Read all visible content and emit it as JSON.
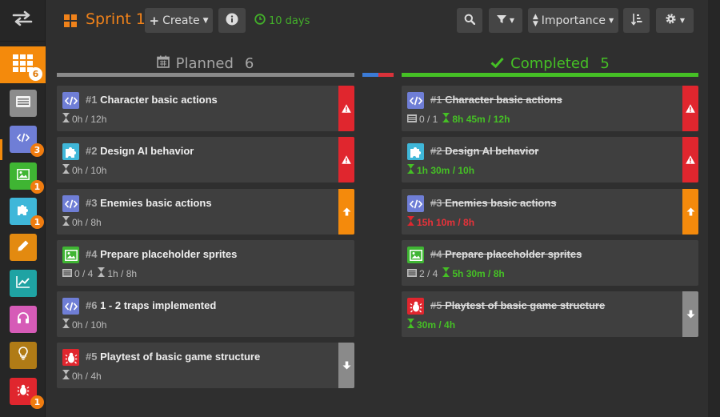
{
  "sidebar": {
    "toggle_icon": "swap-arrows-icon",
    "items": [
      {
        "name": "board",
        "icon": "grid-icon",
        "badge": "6",
        "color": "#f48a0c"
      },
      {
        "name": "backlog",
        "icon": "list-icon",
        "badge": "",
        "color": "#8c8c8c"
      },
      {
        "name": "code",
        "icon": "code-icon",
        "badge": "3",
        "color": "#6f7ed6"
      },
      {
        "name": "graphics",
        "icon": "image-icon",
        "badge": "1",
        "color": "#3fb533"
      },
      {
        "name": "design",
        "icon": "puzzle-icon",
        "badge": "1",
        "color": "#3fb7d9"
      },
      {
        "name": "writing",
        "icon": "pencil-icon",
        "badge": "",
        "color": "#e38a10"
      },
      {
        "name": "stats",
        "icon": "chart-icon",
        "badge": "",
        "color": "#1fa3a3"
      },
      {
        "name": "audio",
        "icon": "headphones-icon",
        "badge": "",
        "color": "#d65bb7"
      },
      {
        "name": "ideas",
        "icon": "lightbulb-icon",
        "badge": "",
        "color": "#b07b16"
      },
      {
        "name": "bugs",
        "icon": "bug-icon",
        "badge": "1",
        "color": "#e0262e"
      }
    ]
  },
  "header": {
    "title": "Sprint 1",
    "create_label": "Create",
    "days_label": "10 days",
    "sort_label": "Importance"
  },
  "columns": [
    {
      "name": "Planned",
      "count": "6",
      "cards": [
        {
          "num": "#1",
          "title": "Character basic actions",
          "type": "code",
          "time": "0h / 12h",
          "tasks": "",
          "spent_style": "plain",
          "priority": "critical"
        },
        {
          "num": "#2",
          "title": "Design AI behavior",
          "type": "design",
          "time": "0h / 10h",
          "tasks": "",
          "spent_style": "plain",
          "priority": "critical"
        },
        {
          "num": "#3",
          "title": "Enemies basic actions",
          "type": "code",
          "time": "0h / 8h",
          "tasks": "",
          "spent_style": "plain",
          "priority": "high"
        },
        {
          "num": "#4",
          "title": "Prepare placeholder sprites",
          "type": "graphics",
          "time": "1h / 8h",
          "tasks": "0 / 4",
          "spent_style": "plain",
          "priority": "none"
        },
        {
          "num": "#6",
          "title": "1 - 2 traps implemented",
          "type": "code",
          "time": "0h / 10h",
          "tasks": "",
          "spent_style": "plain",
          "priority": "none"
        },
        {
          "num": "#5",
          "title": "Playtest of basic game structure",
          "type": "bug",
          "time": "0h / 4h",
          "tasks": "",
          "spent_style": "plain",
          "priority": "low"
        }
      ]
    },
    {
      "name": "Completed",
      "count": "5",
      "cards": [
        {
          "num": "#1",
          "title": "Character basic actions",
          "type": "code",
          "time": "8h 45m / 12h",
          "tasks": "0 / 1",
          "spent_style": "green",
          "priority": "critical"
        },
        {
          "num": "#2",
          "title": "Design AI behavior",
          "type": "design",
          "time": "1h 30m / 10h",
          "tasks": "",
          "spent_style": "green",
          "priority": "critical"
        },
        {
          "num": "#3",
          "title": "Enemies basic actions",
          "type": "code",
          "time": "15h 10m / 8h",
          "tasks": "",
          "spent_style": "red",
          "priority": "high"
        },
        {
          "num": "#4",
          "title": "Prepare placeholder sprites",
          "type": "graphics",
          "time": "5h 30m / 8h",
          "tasks": "2 / 4",
          "spent_style": "green",
          "priority": "none"
        },
        {
          "num": "#5",
          "title": "Playtest of basic game structure",
          "type": "bug",
          "time": "30m / 4h",
          "tasks": "",
          "spent_style": "green",
          "priority": "low"
        }
      ]
    }
  ],
  "colors": {
    "accent": "#f48a0c",
    "completed": "#45c025",
    "critical": "#e0262e",
    "high": "#f48a0c",
    "low": "#8a8a8a",
    "code": "#6f7ed6",
    "design": "#3fb7d9",
    "graphics": "#3fb533",
    "bug": "#e0262e"
  }
}
